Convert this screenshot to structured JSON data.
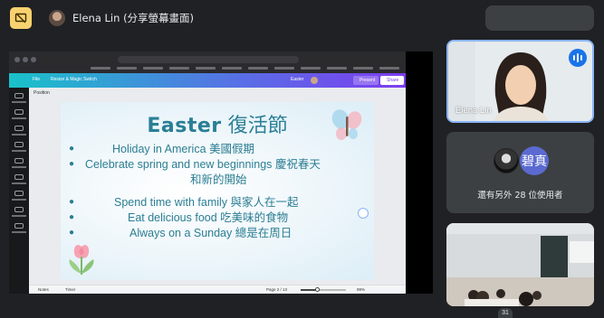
{
  "presenter": {
    "title": "Elena Lin (分享螢幕畫面)"
  },
  "canva": {
    "toolbar": {
      "file": "File",
      "resize": "Resize & Magic Switch",
      "title": "Easter",
      "present": "Present",
      "share": "Share"
    },
    "position_label": "Position",
    "bottom": {
      "notes": "Notes",
      "timer": "Timer",
      "page": "Page 2 / 13",
      "zoom": "99%"
    }
  },
  "slide": {
    "title_en": "Easter",
    "title_zh": "復活節",
    "bullets": [
      {
        "text": "Holiday in America 美國假期",
        "has_dot": true
      },
      {
        "text": "Celebrate spring and new beginnings 慶祝春天",
        "has_dot": true
      },
      {
        "text": "和新的開始",
        "has_dot": false
      },
      {
        "text": "Spend time with family 與家人在一起",
        "has_dot": true
      },
      {
        "text": "Eat delicious food 吃美味的食物",
        "has_dot": true
      },
      {
        "text": "Always on a Sunday 總是在周日",
        "has_dot": true
      }
    ]
  },
  "participants": {
    "elena": {
      "name": "Elena Lin"
    },
    "others": {
      "avatar_text": "碧真",
      "label": "還有另外 28 位使用者"
    },
    "count": "31"
  },
  "colors": {
    "background": "#202124",
    "slide_text": "#2b7e93",
    "accent": "#1a73e8",
    "present_icon": "#f9d26f"
  }
}
